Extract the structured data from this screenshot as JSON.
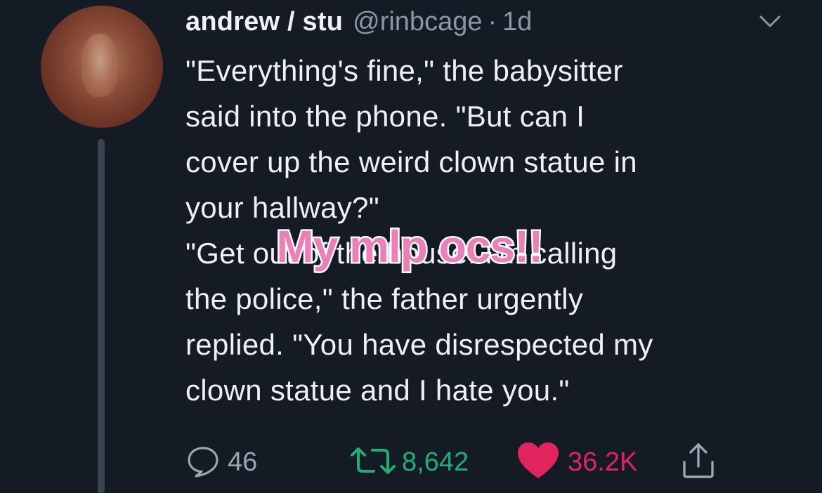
{
  "tweet": {
    "display_name": "andrew / stu",
    "handle": "@rinbcage",
    "separator": "·",
    "time": "1d",
    "lines": [
      "\"Everything's fine,\" the babysitter",
      "said into the phone. \"But can I",
      "cover up the weird clown statue in",
      "your hallway?\"",
      "\"Get out of the house. I'm calling",
      "the police,\" the father urgently",
      "replied. \"You have disrespected my",
      "clown statue and I hate you.\""
    ],
    "overlay_caption": "My mlp ocs!!",
    "actions": {
      "reply_count": "46",
      "retweet_count": "8,642",
      "like_count": "36.2K"
    }
  },
  "icons": {
    "avatar": "profile-photo",
    "menu": "chevron-down-icon",
    "reply": "speech-bubble-icon",
    "retweet": "retweet-arrows-icon",
    "like": "heart-icon",
    "share": "share-upload-icon"
  },
  "colors": {
    "background": "#141b24",
    "text": "#eef1f4",
    "muted": "#8a97a4",
    "retweet_active": "#1fae77",
    "like_active": "#e0245e",
    "overlay_fill": "#ec7fb7",
    "overlay_stroke": "#ffffff"
  }
}
